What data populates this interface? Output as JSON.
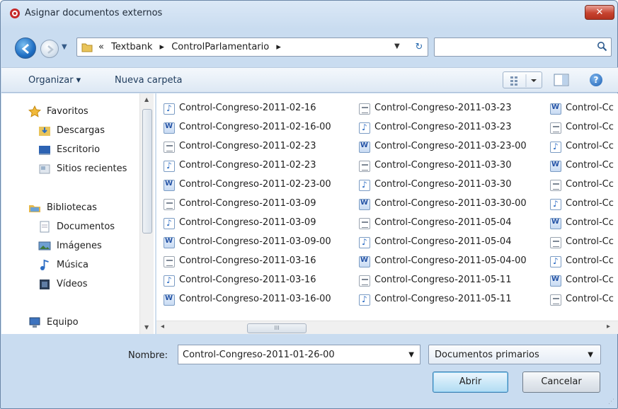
{
  "window": {
    "title": "Asignar documentos externos",
    "close_label": "✕"
  },
  "address": {
    "overflow": "«",
    "crumbs": [
      "Textbank",
      "ControlParlamentario"
    ],
    "separator": "▸",
    "search_placeholder": ""
  },
  "toolbar": {
    "organize_label": "Organizar ▾",
    "new_folder_label": "Nueva carpeta"
  },
  "nav": {
    "favorites": {
      "label": "Favoritos",
      "items": [
        "Descargas",
        "Escritorio",
        "Sitios recientes"
      ]
    },
    "libraries": {
      "label": "Bibliotecas",
      "items": [
        "Documentos",
        "Imágenes",
        "Música",
        "Vídeos"
      ]
    },
    "computer": {
      "label": "Equipo"
    }
  },
  "files": {
    "columns": [
      [
        {
          "name": "Control-Congreso-2011-02-16",
          "icon": "audio"
        },
        {
          "name": "Control-Congreso-2011-02-16-00",
          "icon": "word"
        },
        {
          "name": "Control-Congreso-2011-02-23",
          "icon": "text"
        },
        {
          "name": "Control-Congreso-2011-02-23",
          "icon": "audio"
        },
        {
          "name": "Control-Congreso-2011-02-23-00",
          "icon": "word"
        },
        {
          "name": "Control-Congreso-2011-03-09",
          "icon": "text"
        },
        {
          "name": "Control-Congreso-2011-03-09",
          "icon": "audio"
        },
        {
          "name": "Control-Congreso-2011-03-09-00",
          "icon": "word"
        },
        {
          "name": "Control-Congreso-2011-03-16",
          "icon": "text"
        },
        {
          "name": "Control-Congreso-2011-03-16",
          "icon": "audio"
        },
        {
          "name": "Control-Congreso-2011-03-16-00",
          "icon": "word"
        }
      ],
      [
        {
          "name": "Control-Congreso-2011-03-23",
          "icon": "text"
        },
        {
          "name": "Control-Congreso-2011-03-23",
          "icon": "audio"
        },
        {
          "name": "Control-Congreso-2011-03-23-00",
          "icon": "word"
        },
        {
          "name": "Control-Congreso-2011-03-30",
          "icon": "text"
        },
        {
          "name": "Control-Congreso-2011-03-30",
          "icon": "audio"
        },
        {
          "name": "Control-Congreso-2011-03-30-00",
          "icon": "word"
        },
        {
          "name": "Control-Congreso-2011-05-04",
          "icon": "text"
        },
        {
          "name": "Control-Congreso-2011-05-04",
          "icon": "audio"
        },
        {
          "name": "Control-Congreso-2011-05-04-00",
          "icon": "word"
        },
        {
          "name": "Control-Congreso-2011-05-11",
          "icon": "text"
        },
        {
          "name": "Control-Congreso-2011-05-11",
          "icon": "audio"
        }
      ],
      [
        {
          "name": "Control-Cc",
          "icon": "word"
        },
        {
          "name": "Control-Cc",
          "icon": "text"
        },
        {
          "name": "Control-Cc",
          "icon": "audio"
        },
        {
          "name": "Control-Cc",
          "icon": "word"
        },
        {
          "name": "Control-Cc",
          "icon": "text"
        },
        {
          "name": "Control-Cc",
          "icon": "audio"
        },
        {
          "name": "Control-Cc",
          "icon": "word"
        },
        {
          "name": "Control-Cc",
          "icon": "text"
        },
        {
          "name": "Control-Cc",
          "icon": "audio"
        },
        {
          "name": "Control-Cc",
          "icon": "word"
        },
        {
          "name": "Control-Cc",
          "icon": "text"
        }
      ]
    ],
    "scroll_grip": "III"
  },
  "bottom": {
    "name_label": "Nombre:",
    "name_value": "Control-Congreso-2011-01-26-00",
    "type_value": "Documentos primarios",
    "open_label": "Abrir",
    "cancel_label": "Cancelar"
  },
  "colors": {
    "accent": "#1f6fc4",
    "close": "#c7432f",
    "default_button": "#b2dcf3"
  }
}
